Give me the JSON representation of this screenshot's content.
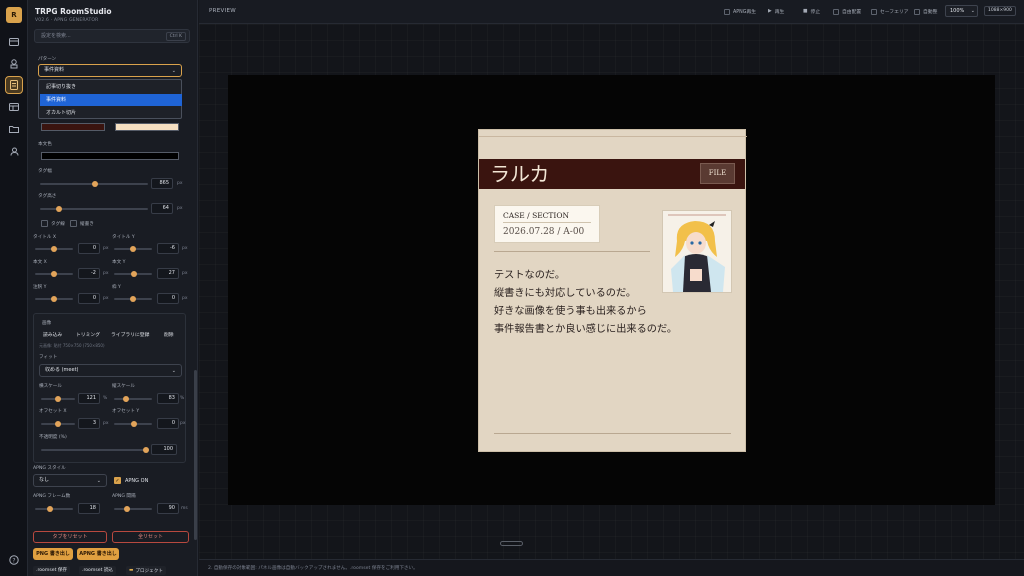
{
  "app": {
    "logo": "R",
    "title": "TRPG RoomStudio",
    "subtitle": "V02.6 · APNG GENERATOR"
  },
  "rail": {
    "icons": [
      "card-icon",
      "stamp-icon",
      "document-icon",
      "template-icon",
      "folder-icon",
      "person-icon"
    ],
    "active": "document-icon",
    "help_icon": "help-icon"
  },
  "search": {
    "placeholder": "設定を検索...",
    "shortcut": "Ctrl K"
  },
  "pattern": {
    "label": "パターン",
    "selected": "事件資料",
    "options": [
      "記事切り抜き",
      "事件資料",
      "オカルト切片"
    ],
    "highlighted_index": 1
  },
  "colors": {
    "swatch_band": "#3a140f",
    "swatch_paper": "#f5dfc1",
    "swatch_text": "#000000",
    "accent": "#d9a24c"
  },
  "text_color_label": "本文色",
  "tag_width": {
    "label": "タグ幅",
    "value": "865",
    "unit": "px",
    "fraction": 0.55
  },
  "tag_height": {
    "label": "タグ高さ",
    "value": "64",
    "unit": "px",
    "fraction": 0.15
  },
  "toggles": {
    "tag_border": "タグ線",
    "vertical": "縦書き"
  },
  "offsets": [
    {
      "label": "タイトル X",
      "value": "0",
      "unit": "px",
      "fraction": 0.5
    },
    {
      "label": "タイトル Y",
      "value": "-6",
      "unit": "px",
      "fraction": 0.48
    },
    {
      "label": "本文 X",
      "value": "-2",
      "unit": "px",
      "fraction": 0.5
    },
    {
      "label": "本文 Y",
      "value": "27",
      "unit": "px",
      "fraction": 0.52
    },
    {
      "label": "注釈 Y",
      "value": "0",
      "unit": "px",
      "fraction": 0.5
    },
    {
      "label": "枠 Y",
      "value": "0",
      "unit": "px",
      "fraction": 0.5
    }
  ],
  "image": {
    "section_label": "画像",
    "buttons": [
      "読み込み",
      "トリミング",
      "ライブラリに登録",
      "削除"
    ],
    "info": "元画像: 貼付 750×750 (750×850)",
    "fit_label": "フィット",
    "fit_value": "収める (meet)",
    "x_scale": {
      "label": "横スケール",
      "value": "121",
      "unit": "%",
      "fraction": 0.3
    },
    "y_scale": {
      "label": "縦スケール",
      "value": "83",
      "unit": "%",
      "fraction": 0.15
    },
    "offset_x": {
      "label": "オフセット X",
      "value": "3",
      "unit": "px",
      "fraction": 0.45
    },
    "offset_y": {
      "label": "オフセット Y",
      "value": "0",
      "unit": "px",
      "fraction": 0.38
    },
    "opacity": {
      "label": "不透明度 (%)",
      "value": "100",
      "fraction": 1.0
    }
  },
  "apng": {
    "style_label": "APNG スタイル",
    "style_value": "なし",
    "on_label": "APNG ON",
    "frames": {
      "label": "APNG フレーム数",
      "value": "18",
      "fraction": 0.3
    },
    "interval": {
      "label": "APNG 間隔",
      "value": "90",
      "unit": "ms",
      "fraction": 0.25
    }
  },
  "footer": {
    "reset_tab": "タブをリセット",
    "reset_all": "全リセット",
    "png_out": "PNG 書き出し",
    "apng_out": "APNG 書き出し",
    "save": ".roomset 保存",
    "load": ".roomset 読込",
    "project": "プロジェクト"
  },
  "topbar": {
    "label": "PREVIEW",
    "items": [
      "APNG再生",
      "再生",
      "停止",
      "自由配置",
      "セーフエリア",
      "自動整"
    ],
    "zoom": "100%",
    "ratio": "1088×900"
  },
  "card": {
    "title": "ラルカ",
    "badge": "FILE",
    "case_label": "CASE / SECTION",
    "case_date": "2026.07.28 / A-00",
    "body": [
      "テストなのだ。",
      "縦書きにも対応しているのだ。",
      "好きな画像を使う事も出来るから",
      "事件報告書とか良い感じに出来るのだ。"
    ]
  },
  "status": "2. 自動保存の対象範囲: パネル画像は自動バックアップされません。.roomset 保存をご利用下さい。"
}
